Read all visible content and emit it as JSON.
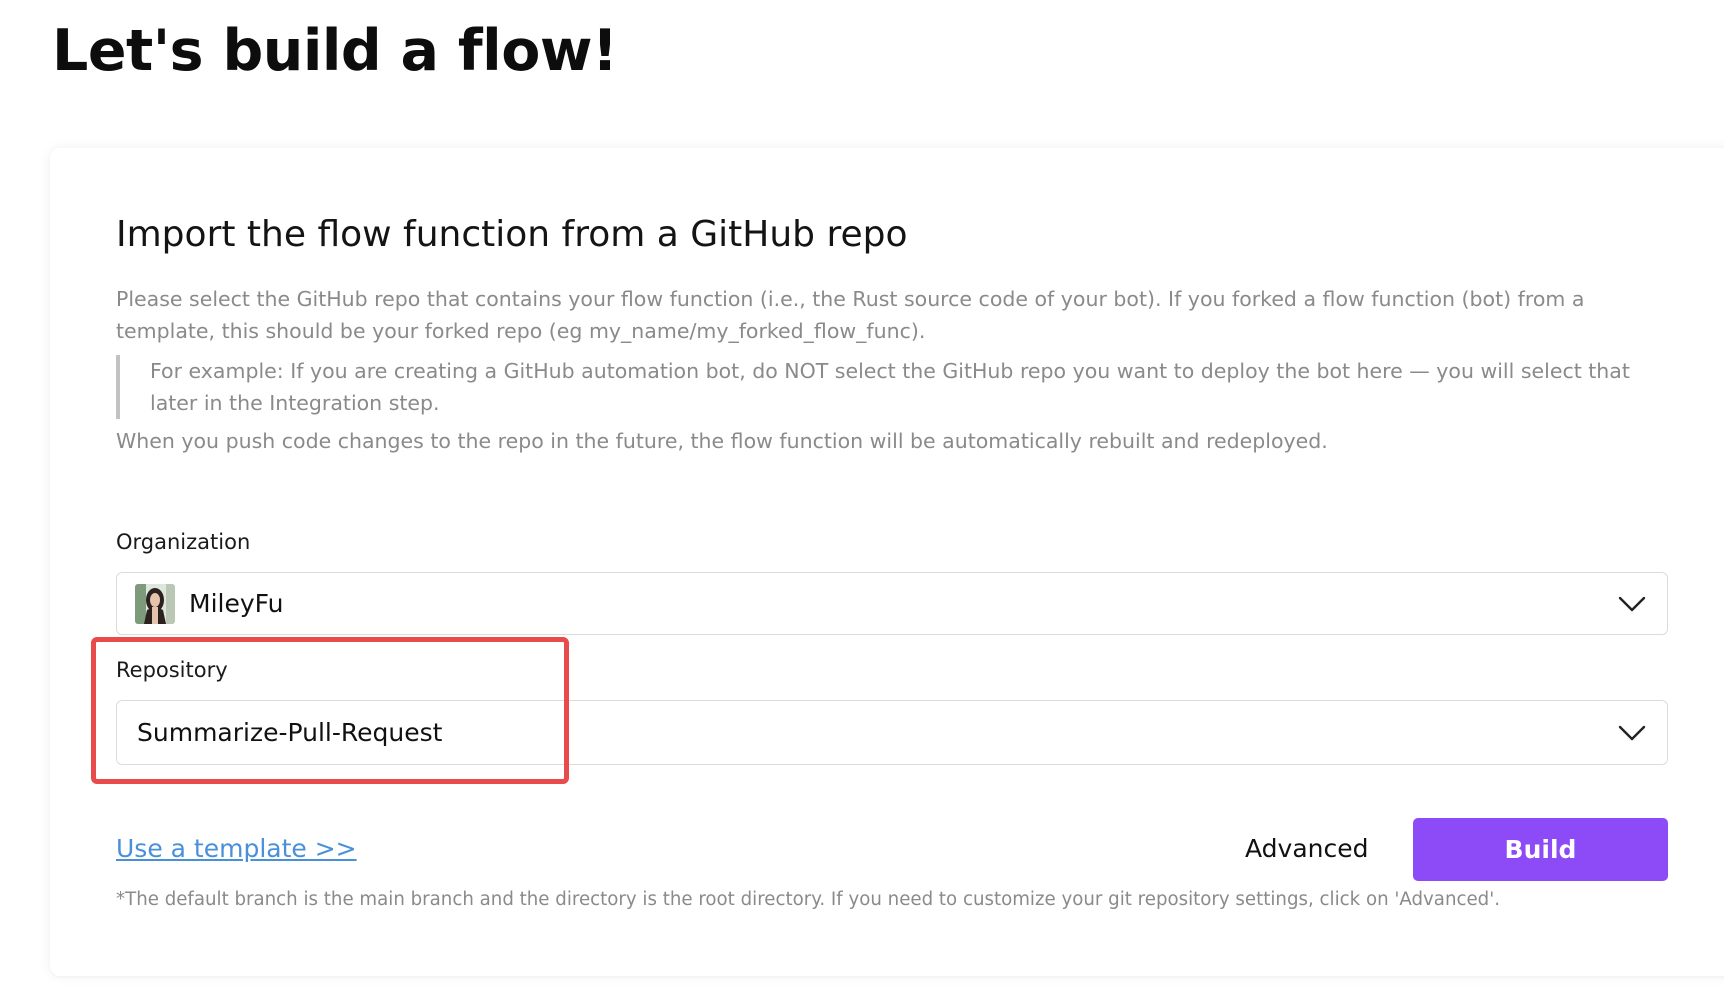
{
  "page": {
    "title": "Let's build a flow!"
  },
  "import_section": {
    "title": "Import the flow function from a GitHub repo",
    "description": "Please select the GitHub repo that contains your flow function (i.e., the Rust source code of your bot). If you forked a flow function (bot) from a template, this should be your forked repo (eg my_name/my_forked_flow_func).",
    "example_note": "For example: If you are creating a GitHub automation bot, do NOT select the GitHub repo you want to deploy the bot here — you will select that later in the Integration step.",
    "auto_rebuild_note": "When you push code changes to the repo in the future, the flow function will be automatically rebuilt and redeployed."
  },
  "organization": {
    "label": "Organization",
    "selected": "MileyFu",
    "icon": "chevron-down-icon"
  },
  "repository": {
    "label": "Repository",
    "selected": "Summarize-Pull-Request",
    "icon": "chevron-down-icon",
    "highlight_color": "#e84b4b"
  },
  "actions": {
    "template_link": "Use a template >>",
    "advanced_label": "Advanced",
    "build_label": "Build"
  },
  "footnote": "*The default branch is the main branch and the directory is the root directory. If you need to customize your git repository settings, click on 'Advanced'.",
  "colors": {
    "accent": "#8d4af7",
    "link": "#4a90d9",
    "muted_text": "#8a8a8a",
    "highlight": "#e84b4b"
  }
}
